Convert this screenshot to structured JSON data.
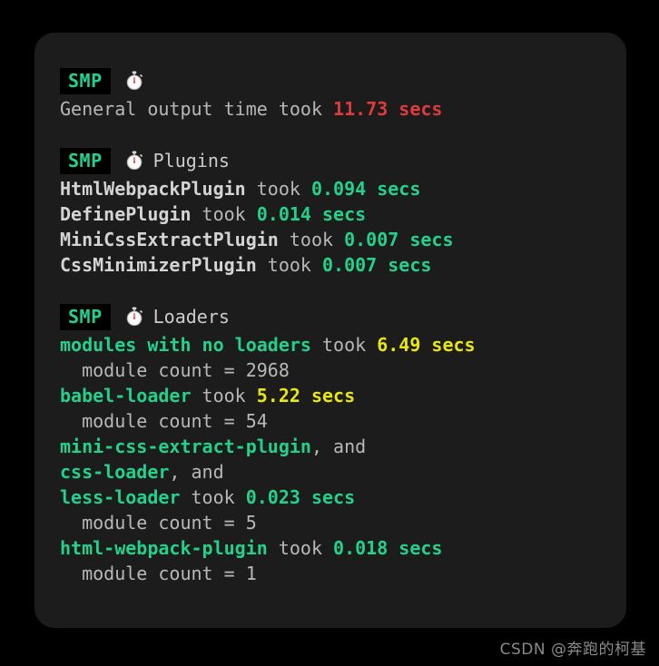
{
  "badge": {
    "label": "SMP",
    "icon": "stopwatch-icon"
  },
  "colors": {
    "card_background": "#1c1c1c",
    "page_background": "#000000",
    "badge_text": "#23d18b",
    "badge_background": "#000000",
    "text": "#cccccc",
    "green": "#23d18b",
    "yellow": "#e8e80f",
    "red": "#e03b3b",
    "watermark": "#8a8a8a"
  },
  "sections": [
    {
      "id": "general",
      "header_title": "",
      "lines": [
        {
          "id": "general-output-time",
          "tokens": [
            {
              "text": "General output time took ",
              "style": "plain"
            },
            {
              "text": "11.73 secs",
              "style": "red"
            }
          ]
        }
      ]
    },
    {
      "id": "plugins",
      "header_title": "Plugins",
      "lines": [
        {
          "id": "html-webpack-plugin-time",
          "tokens": [
            {
              "text": "HtmlWebpackPlugin",
              "style": "w"
            },
            {
              "text": " took ",
              "style": "plain"
            },
            {
              "text": "0.094 secs",
              "style": "green"
            }
          ]
        },
        {
          "id": "define-plugin-time",
          "tokens": [
            {
              "text": "DefinePlugin",
              "style": "w"
            },
            {
              "text": " took ",
              "style": "plain"
            },
            {
              "text": "0.014 secs",
              "style": "green"
            }
          ]
        },
        {
          "id": "mini-css-extract-plugin-time",
          "tokens": [
            {
              "text": "MiniCssExtractPlugin",
              "style": "w"
            },
            {
              "text": " took ",
              "style": "plain"
            },
            {
              "text": "0.007 secs",
              "style": "green"
            }
          ]
        },
        {
          "id": "css-minimizer-plugin-time",
          "tokens": [
            {
              "text": "CssMinimizerPlugin",
              "style": "w"
            },
            {
              "text": " took ",
              "style": "plain"
            },
            {
              "text": "0.007 secs",
              "style": "green"
            }
          ]
        }
      ]
    },
    {
      "id": "loaders",
      "header_title": "Loaders",
      "lines": [
        {
          "id": "no-loaders-time",
          "tokens": [
            {
              "text": "modules with no loaders",
              "style": "green"
            },
            {
              "text": " took ",
              "style": "plain"
            },
            {
              "text": "6.49 secs",
              "style": "yellow"
            }
          ]
        },
        {
          "id": "no-loaders-module-count",
          "tokens": [
            {
              "text": "  module count = 2968",
              "style": "indent"
            }
          ]
        },
        {
          "id": "babel-loader-time",
          "tokens": [
            {
              "text": "babel-loader",
              "style": "green"
            },
            {
              "text": " took ",
              "style": "plain"
            },
            {
              "text": "5.22 secs",
              "style": "yellow"
            }
          ]
        },
        {
          "id": "babel-loader-module-count",
          "tokens": [
            {
              "text": "  module count = 54",
              "style": "indent"
            }
          ]
        },
        {
          "id": "mini-css-extract-plugin-loader",
          "tokens": [
            {
              "text": "mini-css-extract-plugin",
              "style": "green"
            },
            {
              "text": ", and",
              "style": "plain"
            }
          ]
        },
        {
          "id": "css-loader-loader",
          "tokens": [
            {
              "text": "css-loader",
              "style": "green"
            },
            {
              "text": ", and",
              "style": "plain"
            }
          ]
        },
        {
          "id": "less-loader-time",
          "tokens": [
            {
              "text": "less-loader",
              "style": "green"
            },
            {
              "text": " took ",
              "style": "plain"
            },
            {
              "text": "0.023 secs",
              "style": "green"
            }
          ]
        },
        {
          "id": "less-loader-module-count",
          "tokens": [
            {
              "text": "  module count = 5",
              "style": "indent"
            }
          ]
        },
        {
          "id": "html-webpack-plugin-loader-time",
          "tokens": [
            {
              "text": "html-webpack-plugin",
              "style": "green"
            },
            {
              "text": " took ",
              "style": "plain"
            },
            {
              "text": "0.018 secs",
              "style": "green"
            }
          ]
        },
        {
          "id": "html-webpack-plugin-module-count",
          "tokens": [
            {
              "text": "  module count = 1",
              "style": "indent"
            }
          ]
        }
      ]
    }
  ],
  "watermark": {
    "text": "CSDN @奔跑的柯基"
  }
}
